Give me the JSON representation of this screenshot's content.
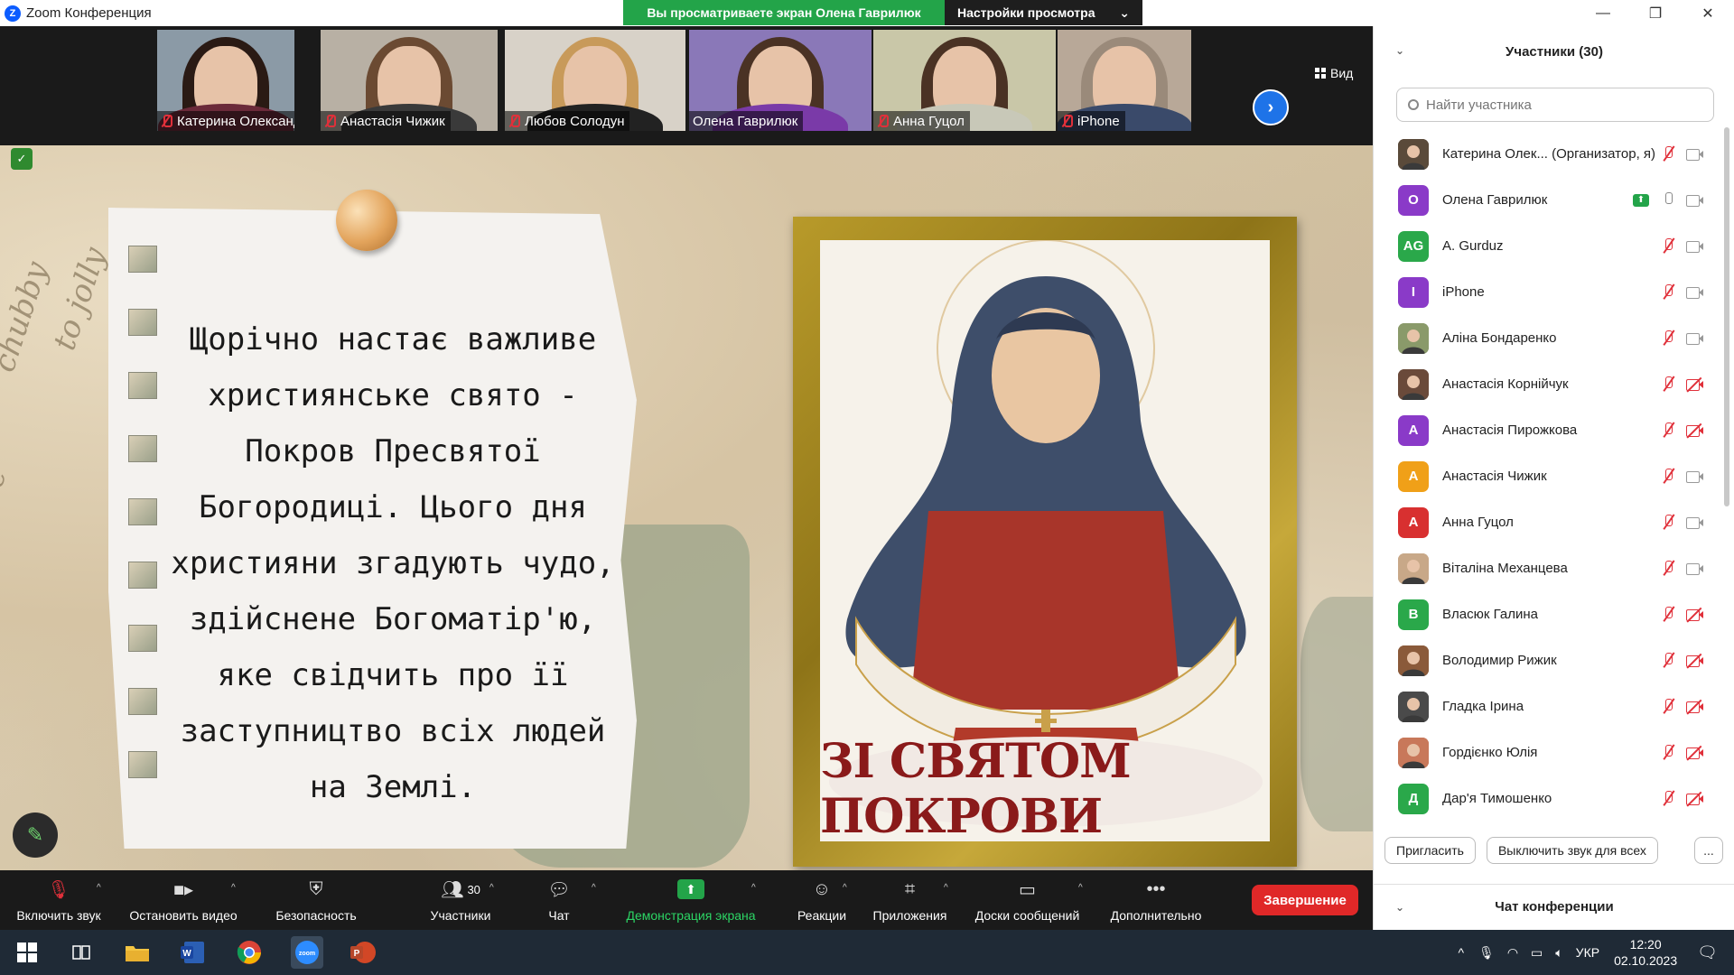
{
  "window": {
    "title": "Zoom Конференция",
    "minimize_icon": "minimize-icon",
    "restore_icon": "restore-icon",
    "close_icon": "close-icon"
  },
  "share_banner": {
    "viewing_text": "Вы просматриваете экран Олена Гаврилюк",
    "view_options": "Настройки просмотра"
  },
  "view_button": "Вид",
  "thumbnails": [
    {
      "name": "Катерина Олександрі...",
      "muted": true,
      "hair": "#2a1a14",
      "body": "#6b2a3a",
      "bg": "#8b9aa6"
    },
    {
      "name": "Анастасія Чижик",
      "muted": true,
      "hair": "#6b4a32",
      "body": "#3a3a3a",
      "bg": "#b8b0a4"
    },
    {
      "name": "Любов Солодун",
      "muted": true,
      "hair": "#c89a5a",
      "body": "#222222",
      "bg": "#d8d2c8"
    },
    {
      "name": "Олена Гаврилюк",
      "muted": false,
      "hair": "#4a3224",
      "body": "#7a3aa8",
      "bg": "#8a78b8"
    },
    {
      "name": "Анна Гуцол",
      "muted": true,
      "hair": "#4a3224",
      "body": "#c8c8b8",
      "bg": "#c9c7a8"
    },
    {
      "name": "iPhone",
      "muted": true,
      "hair": "#9a8a7a",
      "body": "#3a4a6a",
      "bg": "#b8a898"
    }
  ],
  "slide": {
    "lines": [
      "Щорічно настає важливе",
      "християнське свято -",
      "Покров Пресвятої",
      "Богородиці. Цього дня",
      "християни згадують чудо,",
      "здійснене Богоматір'ю,",
      "яке свідчить про її",
      "заступництво всіх людей",
      "на Землі."
    ],
    "icon_caption": "ЗІ СВЯТОМ ПОКРОВИ",
    "bg_words": [
      "chubby",
      "to jolly",
      "Gave"
    ]
  },
  "toolbar": {
    "items": [
      {
        "label": "Включить звук",
        "icon": "microphone-muted-icon"
      },
      {
        "label": "Остановить видео",
        "icon": "video-camera-icon"
      },
      {
        "label": "Безопасность",
        "icon": "shield-icon"
      },
      {
        "label": "Участники",
        "icon": "participants-icon",
        "count": "30"
      },
      {
        "label": "Чат",
        "icon": "chat-bubble-icon"
      },
      {
        "label": "Демонстрация экрана",
        "icon": "share-screen-icon"
      },
      {
        "label": "Реакции",
        "icon": "smiley-icon"
      },
      {
        "label": "Приложения",
        "icon": "apps-icon"
      },
      {
        "label": "Доски сообщений",
        "icon": "whiteboard-icon"
      },
      {
        "label": "Дополнительно",
        "icon": "more-dots-icon"
      }
    ],
    "end_label": "Завершение"
  },
  "panel": {
    "title": "Участники (30)",
    "search_placeholder": "Найти участника",
    "participants": [
      {
        "name": "Катерина Олек... (Организатор, я)",
        "initials": "",
        "color": "#5a4a3a",
        "photo": true,
        "mic": "off",
        "cam": "on"
      },
      {
        "name": "Олена Гаврилюк",
        "initials": "О",
        "color": "#8a3ac8",
        "photo": false,
        "mic": "on",
        "cam": "on",
        "sharing": true
      },
      {
        "name": "A. Gurduz",
        "initials": "AG",
        "color": "#2aa84a",
        "photo": false,
        "mic": "off",
        "cam": "on"
      },
      {
        "name": "iPhone",
        "initials": "I",
        "color": "#8a3ac8",
        "photo": false,
        "mic": "off",
        "cam": "on"
      },
      {
        "name": "Аліна Бондаренко",
        "initials": "",
        "color": "#8a9a6a",
        "photo": true,
        "mic": "off",
        "cam": "on"
      },
      {
        "name": "Анастасія Корнійчук",
        "initials": "",
        "color": "#6a4a3a",
        "photo": true,
        "mic": "off",
        "cam": "off"
      },
      {
        "name": "Анастасія Пирожкова",
        "initials": "А",
        "color": "#8a3ac8",
        "photo": false,
        "mic": "off",
        "cam": "off"
      },
      {
        "name": "Анастасія Чижик",
        "initials": "А",
        "color": "#f0a018",
        "photo": false,
        "mic": "off",
        "cam": "on"
      },
      {
        "name": "Анна Гуцол",
        "initials": "А",
        "color": "#d83030",
        "photo": false,
        "mic": "off",
        "cam": "on"
      },
      {
        "name": "Віталіна Механцева",
        "initials": "",
        "color": "#c8a888",
        "photo": true,
        "mic": "off",
        "cam": "on"
      },
      {
        "name": "Власюк Галина",
        "initials": "В",
        "color": "#2aa84a",
        "photo": false,
        "mic": "off",
        "cam": "off"
      },
      {
        "name": "Володимир Рижик",
        "initials": "",
        "color": "#8a5a3a",
        "photo": true,
        "mic": "off",
        "cam": "off"
      },
      {
        "name": "Гладка Ірина",
        "initials": "",
        "color": "#4a4a4a",
        "photo": true,
        "mic": "off",
        "cam": "off"
      },
      {
        "name": "Гордієнко Юлія",
        "initials": "",
        "color": "#c8785a",
        "photo": true,
        "mic": "off",
        "cam": "off"
      },
      {
        "name": "Дар'я Тимошенко",
        "initials": "Д",
        "color": "#2aa84a",
        "photo": false,
        "mic": "off",
        "cam": "off"
      }
    ],
    "invite_label": "Пригласить",
    "mute_all_label": "Выключить звук для всех",
    "more_label": "...",
    "chat_title": "Чат конференции"
  },
  "taskbar": {
    "apps": [
      "windows-start-icon",
      "task-view-icon",
      "file-explorer-icon",
      "word-icon",
      "chrome-icon",
      "zoom-icon",
      "powerpoint-icon"
    ],
    "language": "УКР",
    "time": "12:20",
    "date": "02.10.2023"
  }
}
